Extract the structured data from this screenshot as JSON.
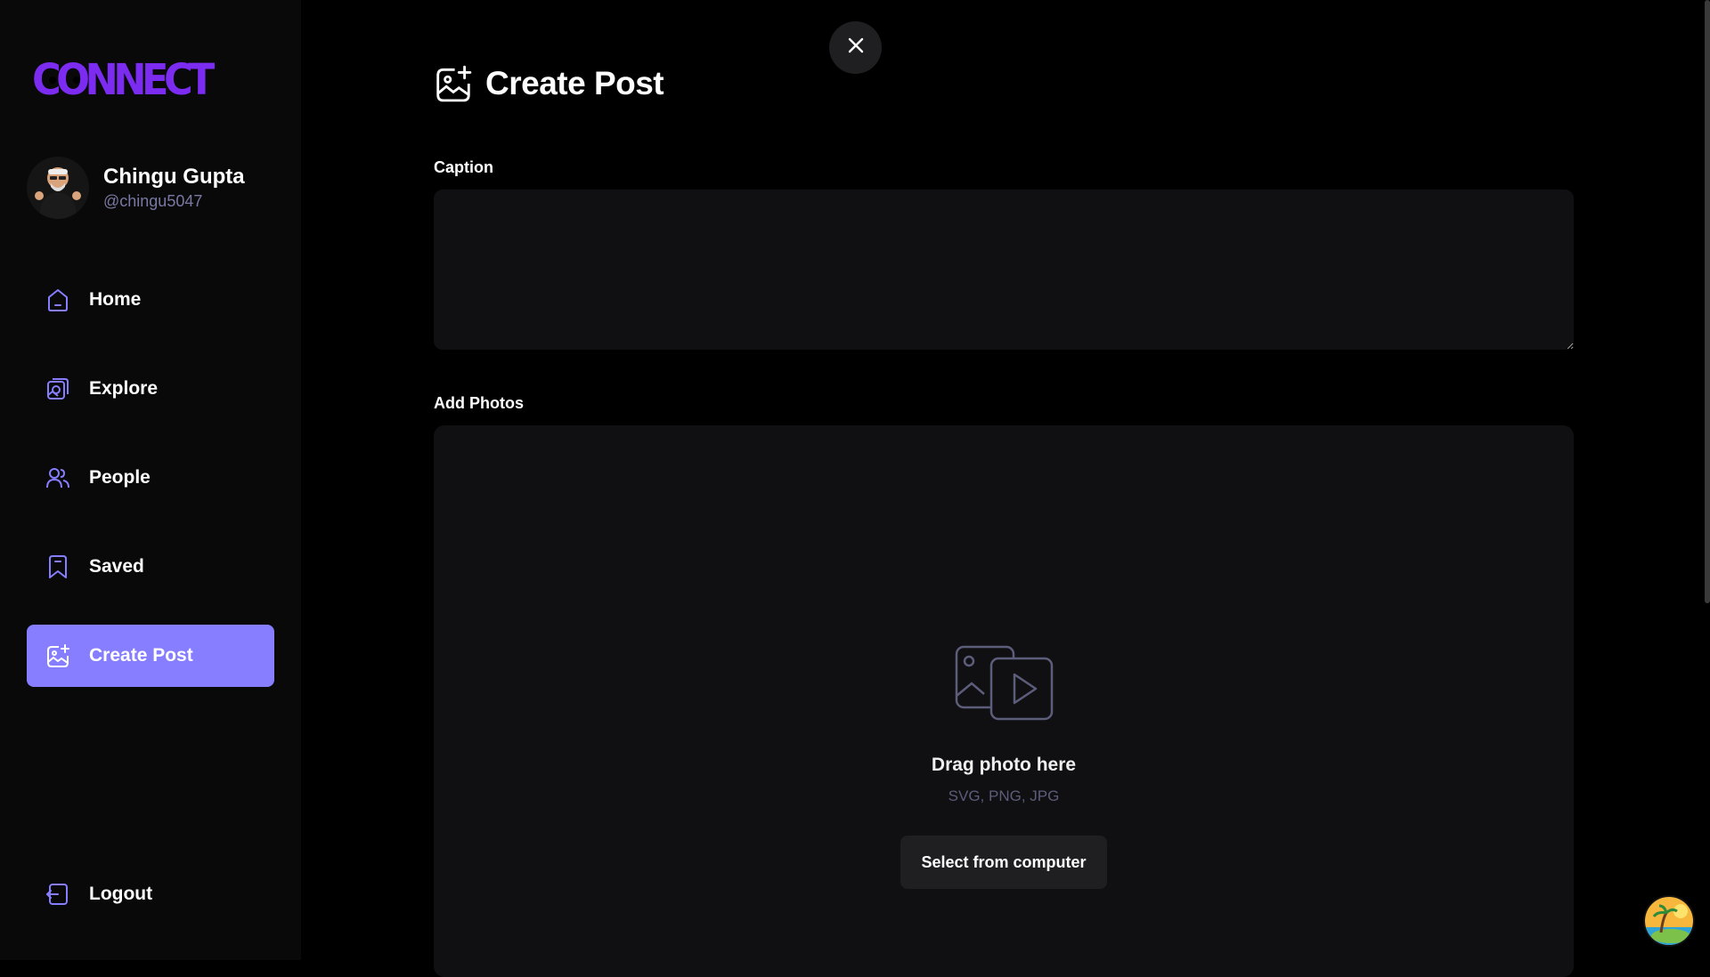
{
  "app": {
    "logo_text": "CONNECT"
  },
  "profile": {
    "name": "Chingu Gupta",
    "handle": "@chingu5047"
  },
  "sidebar": {
    "items": [
      {
        "label": "Home",
        "icon": "home-icon"
      },
      {
        "label": "Explore",
        "icon": "explore-icon"
      },
      {
        "label": "People",
        "icon": "people-icon"
      },
      {
        "label": "Saved",
        "icon": "saved-icon"
      },
      {
        "label": "Create Post",
        "icon": "create-post-icon",
        "active": true
      }
    ],
    "logout_label": "Logout"
  },
  "page": {
    "title": "Create Post"
  },
  "form": {
    "caption_label": "Caption",
    "caption_value": "",
    "photos_label": "Add Photos",
    "drop_title": "Drag photo here",
    "drop_hint": "SVG, PNG, JPG",
    "select_button": "Select from computer"
  },
  "colors": {
    "accent": "#877eff",
    "logo": "#877eff",
    "sidebar_bg": "#09090a",
    "input_bg": "#101012"
  }
}
